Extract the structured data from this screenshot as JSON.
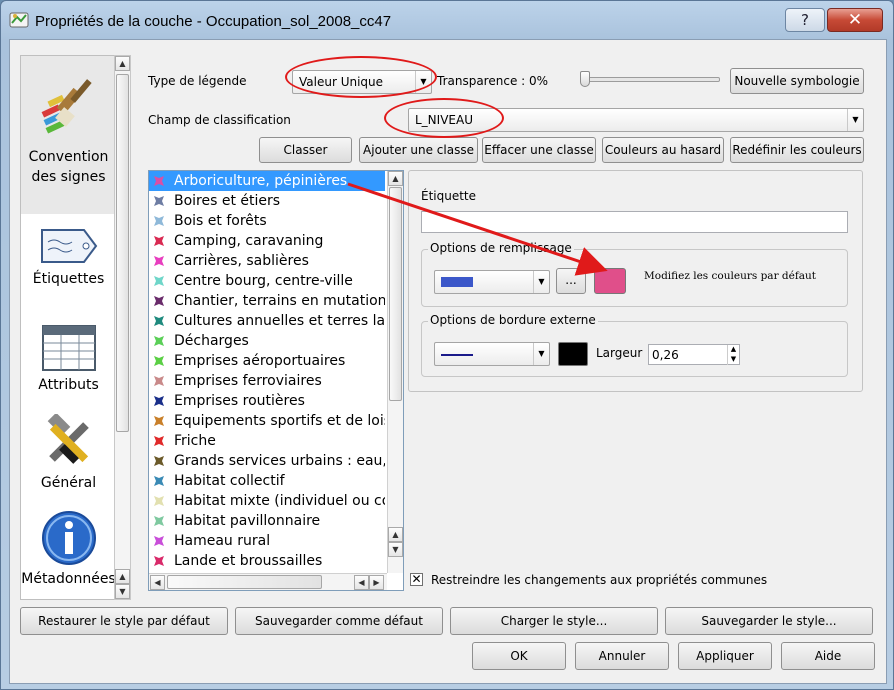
{
  "window": {
    "title": "Propriétés de la couche - Occupation_sol_2008_cc47",
    "help_glyph": "?",
    "close_glyph": "✕"
  },
  "sidebar": {
    "items": [
      {
        "label": "Convention des signes",
        "icon": "paintbrush-icon"
      },
      {
        "label": "Étiquettes",
        "icon": "label-tag-icon"
      },
      {
        "label": "Attributs",
        "icon": "table-icon"
      },
      {
        "label": "Général",
        "icon": "tools-icon"
      },
      {
        "label": "Métadonnées",
        "icon": "info-icon"
      }
    ]
  },
  "legend": {
    "type_label": "Type de légende",
    "type_value": "Valeur Unique",
    "transparency_label": "Transparence : 0%",
    "transparency_value": 0,
    "new_symbology_label": "Nouvelle symbologie",
    "classification_field_label": "Champ de classification",
    "classification_field_value": "L_NIVEAU"
  },
  "actions": {
    "classify": "Classer",
    "add_class": "Ajouter une classe",
    "delete_class": "Effacer une classe",
    "random_colors": "Couleurs au hasard",
    "reset_colors": "Redéfinir les couleurs"
  },
  "classes": [
    {
      "name": "Arboriculture, pépinières",
      "color": "#d94fa5",
      "selected": true
    },
    {
      "name": "Boires et étiers",
      "color": "#6e7da3"
    },
    {
      "name": "Bois et forêts",
      "color": "#8fb9d9"
    },
    {
      "name": "Camping, caravaning",
      "color": "#d92a52"
    },
    {
      "name": "Carrières, sablières",
      "color": "#e83fbf"
    },
    {
      "name": "Centre bourg, centre-ville",
      "color": "#6fd6c9"
    },
    {
      "name": "Chantier, terrains en mutation",
      "color": "#6a2c6b"
    },
    {
      "name": "Cultures annuelles et terres labo",
      "color": "#1f8a7e"
    },
    {
      "name": "Décharges",
      "color": "#5bcf58"
    },
    {
      "name": "Emprises aéroportuaires",
      "color": "#5bcf45"
    },
    {
      "name": "Emprises ferroviaires",
      "color": "#c98a8a"
    },
    {
      "name": "Emprises routières",
      "color": "#1a2f8a"
    },
    {
      "name": "Equipements sportifs et de loisir",
      "color": "#c9802a"
    },
    {
      "name": "Friche",
      "color": "#e02a2a"
    },
    {
      "name": "Grands services urbains : eau, ass",
      "color": "#6b5a2a"
    },
    {
      "name": "Habitat collectif",
      "color": "#3a8ab5"
    },
    {
      "name": "Habitat mixte (individuel ou coll",
      "color": "#e2e0b0"
    },
    {
      "name": "Habitat pavillonnaire",
      "color": "#7fc9a0"
    },
    {
      "name": "Hameau rural",
      "color": "#c94fd9"
    },
    {
      "name": "Lande et broussailles",
      "color": "#d92a6a"
    }
  ],
  "symbol": {
    "label_caption": "Étiquette",
    "label_value": "",
    "fill_group_title": "Options de remplissage",
    "fill_pattern_color": "#3b57c9",
    "fill_browse_label": "...",
    "fill_color": "#e04f8a",
    "annotation": "Modifiez les couleurs par défaut",
    "border_group_title": "Options de bordure externe",
    "border_line_color": "#1a1a8a",
    "border_color": "#000000",
    "width_label": "Largeur",
    "width_value": "0,26"
  },
  "restrict": {
    "checked": true,
    "mark": "✕",
    "label": "Restreindre les changements aux propriétés communes"
  },
  "footer": {
    "restore_default": "Restaurer le style par défaut",
    "save_default": "Sauvegarder comme défaut",
    "load_style": "Charger le style...",
    "save_style": "Sauvegarder le style...",
    "ok": "OK",
    "cancel": "Annuler",
    "apply": "Appliquer",
    "help": "Aide"
  },
  "colors": {
    "selection": "#3399ff",
    "highlight_ellipse": "#e01a1a"
  }
}
